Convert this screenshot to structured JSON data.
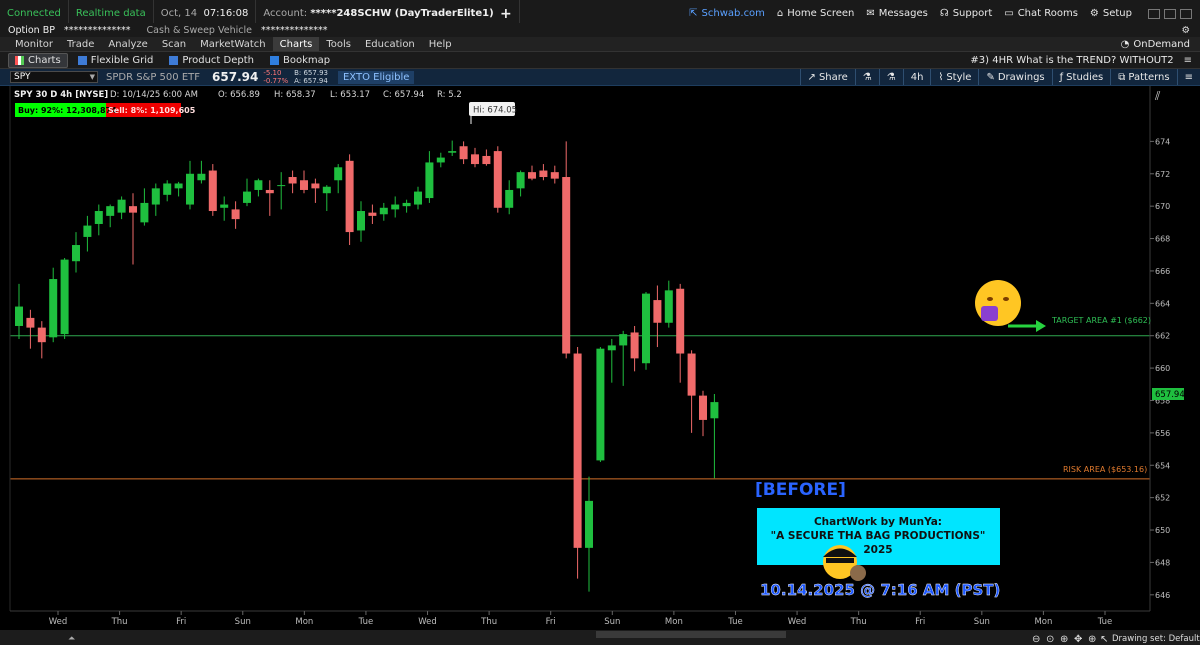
{
  "topbar": {
    "connected": "Connected",
    "realtime": "Realtime data",
    "date": "Oct, 14",
    "time": "07:16:08",
    "account_label": "Account:",
    "account_value": "*****248SCHW (DayTraderElite1)",
    "plus": "+",
    "links": [
      {
        "label": "Schwab.com",
        "icon": "external-link-icon"
      },
      {
        "label": "Home Screen",
        "icon": "home-icon"
      },
      {
        "label": "Messages",
        "icon": "mail-icon"
      },
      {
        "label": "Support",
        "icon": "headset-icon"
      },
      {
        "label": "Chat Rooms",
        "icon": "chat-icon"
      },
      {
        "label": "Setup",
        "icon": "gear-icon"
      }
    ]
  },
  "bp": {
    "option_bp": "Option BP",
    "option_bp_value": "**************",
    "cash_sweep": "Cash & Sweep Vehicle",
    "cash_value": "**************"
  },
  "menu": {
    "items": [
      "Monitor",
      "Trade",
      "Analyze",
      "Scan",
      "MarketWatch",
      "Charts",
      "Tools",
      "Education",
      "Help"
    ],
    "active": "Charts",
    "ondemand": "OnDemand"
  },
  "chartbar": {
    "tabs": [
      {
        "label": "Charts",
        "active": true
      },
      {
        "label": "Flexible Grid",
        "active": false
      },
      {
        "label": "Product Depth",
        "active": false
      },
      {
        "label": "Bookmap",
        "active": false
      }
    ],
    "workspace": "#3) 4HR What is the TREND? WITHOUT2"
  },
  "symbol": {
    "ticker": "SPY",
    "description": "SPDR S&P 500 ETF",
    "last": "657.94",
    "change": "-5.10",
    "change_pct": "-0.77%",
    "bid": "B: 657.93",
    "ask": "A: 657.94",
    "exto": "EXTO Eligible",
    "share": "Share",
    "aggregation": "4h",
    "style": "Style",
    "drawings": "Drawings",
    "studies": "Studies",
    "patterns": "Patterns"
  },
  "header": {
    "title": "SPY 30 D 4h [NYSE]",
    "d": "D: 10/14/25 6:00 AM",
    "o": "O: 656.89",
    "h": "H: 658.37",
    "l": "L: 653.17",
    "c": "C: 657.94",
    "r": "R: 5.2"
  },
  "buy_label": "Buy: 92%: 12,308,874",
  "sell_label": "Sell: 8%: 1,109,605",
  "hi_label": "Hi: 674.05",
  "target_label": "TARGET AREA #1 ($662)",
  "risk_label": "RISK AREA  ($653.16)",
  "price_tag": "657.94",
  "before_label": "[BEFORE]",
  "credit_lines": [
    "ChartWork by MunYa:",
    "\"A SECURE THA BAG PRODUCTIONS\"",
    "2025"
  ],
  "timestamp_label": "10.14.2025 @ 7:16 AM (PST)",
  "drawing_set": "Drawing set: Default",
  "colors": {
    "up": "#1fbf3f",
    "down": "#f06a6a",
    "target_line": "#2fa84f",
    "risk_line": "#d4702a",
    "credit_box": "#00e5ff",
    "timestamp": "#1c57ff",
    "before": "#2a64ff"
  },
  "chart_data": {
    "type": "candlestick",
    "title": "SPY 30 D 4h [NYSE]",
    "ylim": [
      645,
      676
    ],
    "y_ticks": [
      646,
      648,
      650,
      652,
      654,
      656,
      658,
      660,
      662,
      664,
      666,
      668,
      670,
      672,
      674
    ],
    "x_labels": [
      "Wed",
      "Thu",
      "Fri",
      "Sun",
      "Mon",
      "Tue",
      "Wed",
      "Thu",
      "Fri",
      "Sun",
      "Mon",
      "Tue",
      "Wed",
      "Thu",
      "Fri",
      "Sun",
      "Mon",
      "Tue"
    ],
    "hlines": [
      {
        "name": "TARGET AREA #1 ($662)",
        "value": 662
      },
      {
        "name": "RISK AREA  ($653.16)",
        "value": 653.16
      }
    ],
    "candles": [
      {
        "o": 662.6,
        "h": 665.2,
        "l": 661.8,
        "c": 663.8
      },
      {
        "o": 663.1,
        "h": 663.6,
        "l": 661.2,
        "c": 662.5
      },
      {
        "o": 662.5,
        "h": 662.9,
        "l": 660.6,
        "c": 661.6
      },
      {
        "o": 661.9,
        "h": 666.2,
        "l": 661.6,
        "c": 665.5
      },
      {
        "o": 662.1,
        "h": 666.8,
        "l": 661.8,
        "c": 666.7
      },
      {
        "o": 666.6,
        "h": 668.4,
        "l": 665.9,
        "c": 667.6
      },
      {
        "o": 668.1,
        "h": 669.4,
        "l": 667.2,
        "c": 668.8
      },
      {
        "o": 668.9,
        "h": 670.1,
        "l": 668.2,
        "c": 669.7
      },
      {
        "o": 669.4,
        "h": 670.1,
        "l": 668.7,
        "c": 670.0
      },
      {
        "o": 669.6,
        "h": 670.6,
        "l": 669.2,
        "c": 670.4
      },
      {
        "o": 670.0,
        "h": 670.8,
        "l": 666.4,
        "c": 669.6
      },
      {
        "o": 669.0,
        "h": 671.1,
        "l": 668.8,
        "c": 670.2
      },
      {
        "o": 670.1,
        "h": 671.4,
        "l": 669.4,
        "c": 671.1
      },
      {
        "o": 670.7,
        "h": 671.6,
        "l": 670.3,
        "c": 671.4
      },
      {
        "o": 671.1,
        "h": 671.5,
        "l": 670.6,
        "c": 671.4
      },
      {
        "o": 670.1,
        "h": 672.8,
        "l": 669.8,
        "c": 672.0
      },
      {
        "o": 671.6,
        "h": 672.8,
        "l": 671.4,
        "c": 672.0
      },
      {
        "o": 672.2,
        "h": 672.6,
        "l": 669.4,
        "c": 669.7
      },
      {
        "o": 669.9,
        "h": 670.6,
        "l": 669.1,
        "c": 670.1
      },
      {
        "o": 669.8,
        "h": 670.3,
        "l": 668.6,
        "c": 669.2
      },
      {
        "o": 670.2,
        "h": 671.7,
        "l": 670.0,
        "c": 670.9
      },
      {
        "o": 671.0,
        "h": 671.7,
        "l": 670.6,
        "c": 671.6
      },
      {
        "o": 671.0,
        "h": 671.6,
        "l": 669.4,
        "c": 670.8
      },
      {
        "o": 671.3,
        "h": 672.1,
        "l": 669.8,
        "c": 671.3
      },
      {
        "o": 671.8,
        "h": 672.2,
        "l": 670.8,
        "c": 671.4
      },
      {
        "o": 671.6,
        "h": 672.2,
        "l": 670.8,
        "c": 671.0
      },
      {
        "o": 671.4,
        "h": 671.7,
        "l": 670.2,
        "c": 671.1
      },
      {
        "o": 670.8,
        "h": 671.3,
        "l": 669.7,
        "c": 671.2
      },
      {
        "o": 671.6,
        "h": 672.6,
        "l": 670.8,
        "c": 672.4
      },
      {
        "o": 672.8,
        "h": 673.2,
        "l": 667.6,
        "c": 668.4
      },
      {
        "o": 668.5,
        "h": 670.3,
        "l": 667.8,
        "c": 669.7
      },
      {
        "o": 669.6,
        "h": 670.1,
        "l": 668.9,
        "c": 669.4
      },
      {
        "o": 669.5,
        "h": 670.2,
        "l": 669.1,
        "c": 669.9
      },
      {
        "o": 669.8,
        "h": 670.6,
        "l": 669.3,
        "c": 670.1
      },
      {
        "o": 670.0,
        "h": 670.4,
        "l": 669.6,
        "c": 670.2
      },
      {
        "o": 670.1,
        "h": 671.2,
        "l": 669.8,
        "c": 670.9
      },
      {
        "o": 670.5,
        "h": 673.4,
        "l": 670.2,
        "c": 672.7
      },
      {
        "o": 672.7,
        "h": 673.3,
        "l": 672.4,
        "c": 673.0
      },
      {
        "o": 673.3,
        "h": 674.05,
        "l": 673.1,
        "c": 673.4
      },
      {
        "o": 673.7,
        "h": 674.0,
        "l": 672.6,
        "c": 672.9
      },
      {
        "o": 673.2,
        "h": 673.6,
        "l": 672.4,
        "c": 672.6
      },
      {
        "o": 673.1,
        "h": 673.5,
        "l": 672.5,
        "c": 672.6
      },
      {
        "o": 673.4,
        "h": 673.7,
        "l": 669.6,
        "c": 669.9
      },
      {
        "o": 669.9,
        "h": 671.6,
        "l": 669.5,
        "c": 671.0
      },
      {
        "o": 671.1,
        "h": 672.2,
        "l": 670.6,
        "c": 672.1
      },
      {
        "o": 672.1,
        "h": 672.5,
        "l": 671.6,
        "c": 671.7
      },
      {
        "o": 672.2,
        "h": 672.6,
        "l": 671.6,
        "c": 671.8
      },
      {
        "o": 672.1,
        "h": 672.5,
        "l": 671.4,
        "c": 671.7
      },
      {
        "o": 671.8,
        "h": 674.0,
        "l": 660.6,
        "c": 660.9
      },
      {
        "o": 660.9,
        "h": 661.3,
        "l": 647.0,
        "c": 648.9
      },
      {
        "o": 648.9,
        "h": 653.3,
        "l": 646.2,
        "c": 651.8
      },
      {
        "o": 654.3,
        "h": 661.3,
        "l": 654.2,
        "c": 661.2
      },
      {
        "o": 661.1,
        "h": 661.8,
        "l": 659.1,
        "c": 661.4
      },
      {
        "o": 661.4,
        "h": 662.3,
        "l": 658.9,
        "c": 662.1
      },
      {
        "o": 662.2,
        "h": 662.6,
        "l": 659.8,
        "c": 660.6
      },
      {
        "o": 660.3,
        "h": 664.7,
        "l": 659.9,
        "c": 664.6
      },
      {
        "o": 664.2,
        "h": 665.1,
        "l": 661.3,
        "c": 662.8
      },
      {
        "o": 662.8,
        "h": 665.4,
        "l": 662.5,
        "c": 664.8
      },
      {
        "o": 664.9,
        "h": 665.2,
        "l": 659.1,
        "c": 660.9
      },
      {
        "o": 660.9,
        "h": 661.1,
        "l": 656.0,
        "c": 658.3
      },
      {
        "o": 658.3,
        "h": 658.6,
        "l": 655.8,
        "c": 656.8
      },
      {
        "o": 656.9,
        "h": 658.4,
        "l": 653.2,
        "c": 657.9
      }
    ]
  }
}
